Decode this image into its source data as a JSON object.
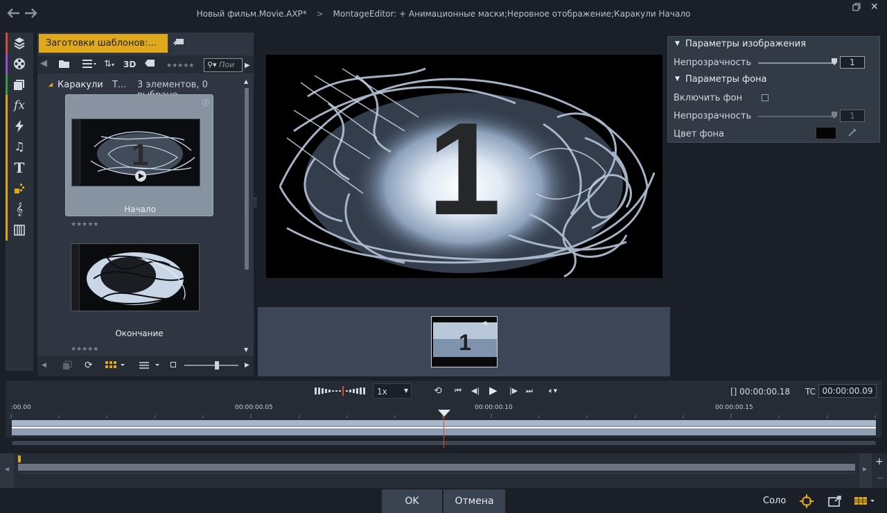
{
  "titlebar": {
    "project": "Новый фильм.Movie.AXP*",
    "separator": ">",
    "editor": "MontageEditor: + Анимационные маски;Неровное отображение;Каракули  Начало"
  },
  "library": {
    "tab_label": "Заготовки шаблонов:...",
    "search_placeholder": "Пои",
    "toolbar_3d": "3D",
    "breadcrumb": {
      "folder": "Каракули",
      "col": "Т...",
      "count": "3 элементов, 0 выбрано"
    },
    "items": [
      {
        "label": "Начало",
        "stars": "★★★★★"
      },
      {
        "label": "Окончание",
        "stars": "★★★★★"
      }
    ]
  },
  "params": {
    "image_section": "Параметры изображения",
    "opacity_label": "Непрозрачность",
    "opacity_value": "1",
    "bg_section": "Параметры фона",
    "enable_bg_label": "Включить фон",
    "bg_opacity_label": "Непрозрачность",
    "bg_opacity_value": "1",
    "bg_color_label": "Цвет фона"
  },
  "preview": {
    "number": "1"
  },
  "transport": {
    "speed": "1x",
    "duration": "[] 00:00:00.18",
    "tc_label": "TC",
    "timecode": "00:00:00.09"
  },
  "ruler": {
    "ticks": [
      ":00.00",
      "00:00:00.05",
      "00:00:00.10",
      "00:00:00.15"
    ]
  },
  "footer": {
    "ok": "OK",
    "cancel": "Отмена",
    "solo": "Соло"
  },
  "colors": {
    "accent": "#e0a81c",
    "playhead": "#e04a2a",
    "strip": [
      "#d94a3a",
      "#9a4fd0",
      "#3e9b45",
      "#e0a81c"
    ]
  }
}
